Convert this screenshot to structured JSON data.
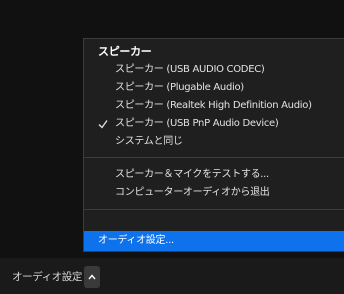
{
  "menu": {
    "speaker_header": "スピーカー",
    "speaker_items": [
      {
        "label": "スピーカー (USB AUDIO  CODEC)",
        "checked": false
      },
      {
        "label": "スピーカー (Plugable Audio)",
        "checked": false
      },
      {
        "label": "スピーカー (Realtek High Definition Audio)",
        "checked": false
      },
      {
        "label": "スピーカー (USB PnP Audio Device)",
        "checked": true
      },
      {
        "label": "システムと同じ",
        "checked": false
      }
    ],
    "test_item": "スピーカー＆マイクをテストする...",
    "leave_item": "コンピューターオーディオから退出",
    "settings_item": "オーディオ設定..."
  },
  "bottom_bar": {
    "audio_settings_label": "オーディオ設定"
  },
  "colors": {
    "highlight": "#0e72ed",
    "menu_bg": "#1f1f1f",
    "background": "#111111"
  },
  "icons": {
    "check": "check-icon",
    "caret": "chevron-up-icon"
  }
}
